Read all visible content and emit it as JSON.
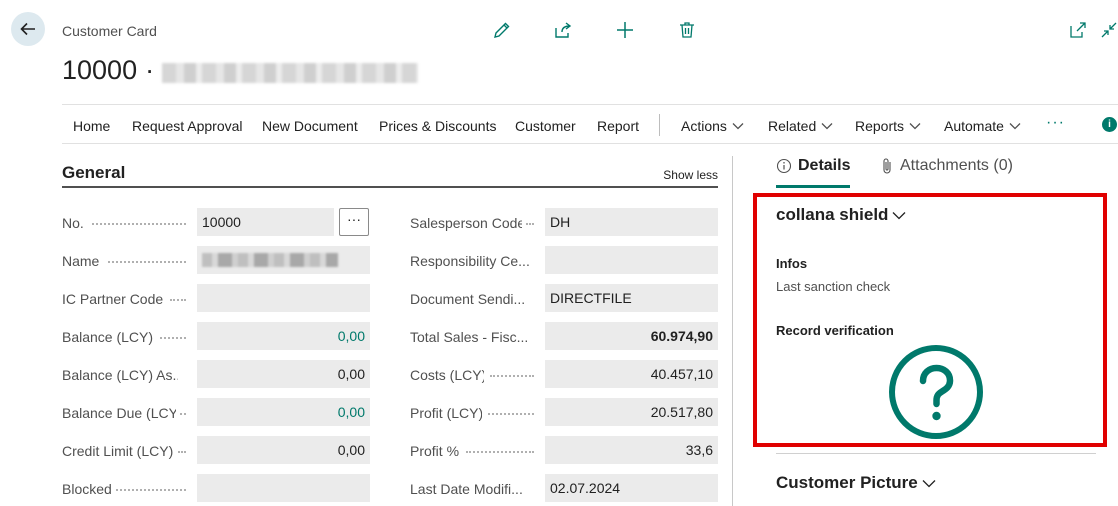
{
  "header": {
    "page_type": "Customer Card",
    "number": "10000",
    "separator": "·"
  },
  "toolbar": {
    "icons": [
      "edit-icon",
      "share-icon",
      "add-icon",
      "delete-icon",
      "open-new-window-icon",
      "collapse-icon"
    ]
  },
  "actionbar": {
    "items": [
      {
        "label": "Home"
      },
      {
        "label": "Request Approval"
      },
      {
        "label": "New Document"
      },
      {
        "label": "Prices & Discounts"
      },
      {
        "label": "Customer"
      },
      {
        "label": "Report"
      },
      {
        "label": "Actions"
      },
      {
        "label": "Related"
      },
      {
        "label": "Reports"
      },
      {
        "label": "Automate"
      }
    ],
    "more": "···",
    "info": "i"
  },
  "general": {
    "title": "General",
    "toggle": "Show less",
    "left_fields": [
      {
        "label": "No.",
        "value": "10000"
      },
      {
        "label": "Name",
        "value": ""
      },
      {
        "label": "IC Partner Code",
        "value": ""
      },
      {
        "label": "Balance (LCY)",
        "value": "0,00"
      },
      {
        "label": "Balance (LCY) As...",
        "value": "0,00"
      },
      {
        "label": "Balance Due (LCY)",
        "value": "0,00"
      },
      {
        "label": "Credit Limit (LCY)",
        "value": "0,00"
      },
      {
        "label": "Blocked",
        "value": ""
      }
    ],
    "right_fields": [
      {
        "label": "Salesperson Code",
        "value": "DH"
      },
      {
        "label": "Responsibility Ce...",
        "value": ""
      },
      {
        "label": "Document Sendi...",
        "value": "DIRECTFILE"
      },
      {
        "label": "Total Sales - Fisc...",
        "value": "60.974,90"
      },
      {
        "label": "Costs (LCY)",
        "value": "40.457,10"
      },
      {
        "label": "Profit (LCY)",
        "value": "20.517,80"
      },
      {
        "label": "Profit %",
        "value": "33,6"
      },
      {
        "label": "Last Date Modifi...",
        "value": "02.07.2024"
      }
    ],
    "no_lookup": "···"
  },
  "factbox": {
    "tabs": [
      {
        "label": "Details",
        "icon": "info-icon"
      },
      {
        "label": "Attachments (0)",
        "icon": "paperclip-icon"
      }
    ],
    "shield": {
      "title": "collana shield",
      "infos_label": "Infos",
      "infos_link": "Last sanction check",
      "verification_label": "Record verification",
      "status_icon": "question-mark-icon"
    },
    "picture_title": "Customer Picture"
  },
  "colors": {
    "accent": "#00796b",
    "highlight": "#e00000",
    "field_bg": "#ebebeb"
  }
}
